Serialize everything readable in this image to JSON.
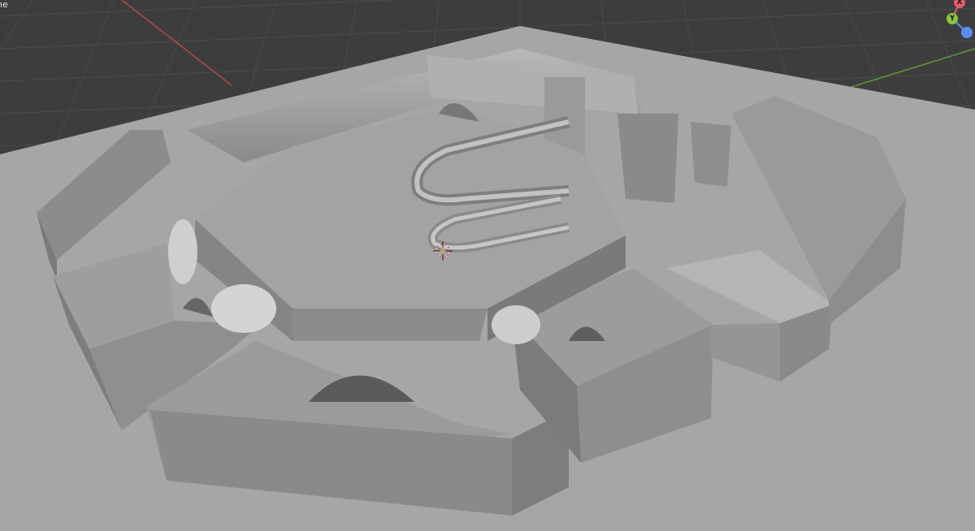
{
  "app": {
    "mode_label": "ne"
  },
  "gizmo": {
    "x_label": "X",
    "y_label": "Y",
    "z_label": "",
    "x_color": "#e85b6e",
    "y_color": "#8bc53f",
    "z_color": "#5b8ef0"
  },
  "viewport": {
    "background": "#3d3d3d",
    "grid_color": "#4a4a4a",
    "x_axis_color": "#b24a4a",
    "y_axis_color": "#5f9a3a",
    "model_color": "#9a9a9a"
  }
}
